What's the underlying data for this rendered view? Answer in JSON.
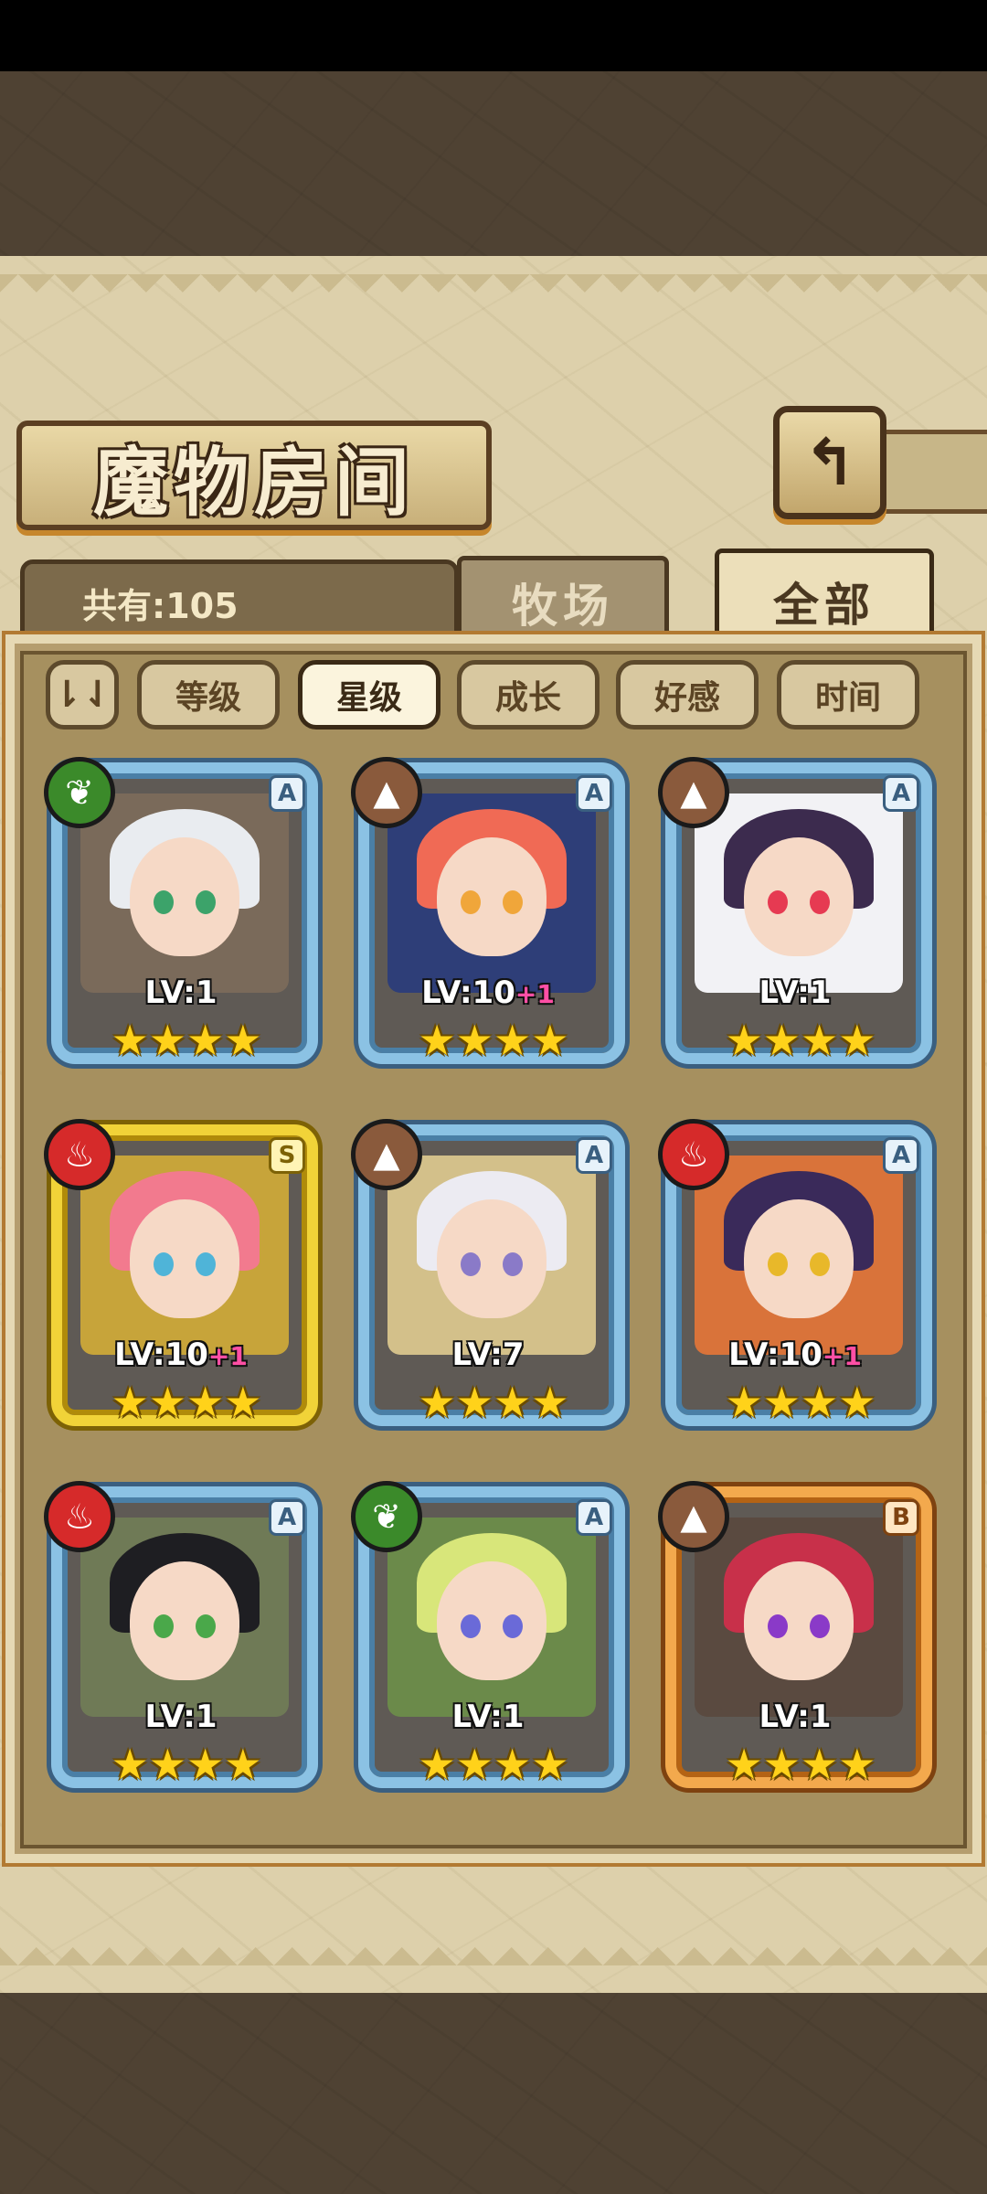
{
  "header": {
    "title": "魔物房间",
    "back_icon": "↰"
  },
  "count": {
    "label": "共有:105"
  },
  "tabs": [
    {
      "label": "牧场",
      "active": false
    },
    {
      "label": "全部",
      "active": true
    }
  ],
  "filters": {
    "toggle_icon": "⇂⇃",
    "items": [
      {
        "label": "等级",
        "active": false
      },
      {
        "label": "星级",
        "active": true
      },
      {
        "label": "成长",
        "active": false
      },
      {
        "label": "好感",
        "active": false
      },
      {
        "label": "时间",
        "active": false
      }
    ]
  },
  "monsters": [
    {
      "element": "grass",
      "element_icon": "❦",
      "rank": "A",
      "level": "LV:1",
      "plus": "",
      "stars": "★★★★",
      "hair": "#e9ecf0",
      "eye": "#3ca36a",
      "bg": "#7a6a5a"
    },
    {
      "element": "earth",
      "element_icon": "▲",
      "rank": "A",
      "level": "LV:10",
      "plus": "+1",
      "stars": "★★★★",
      "hair": "#f06a55",
      "eye": "#f0a63a",
      "bg": "#2e3e78"
    },
    {
      "element": "earth",
      "element_icon": "▲",
      "rank": "A",
      "level": "LV:1",
      "plus": "",
      "stars": "★★★★",
      "hair": "#3c2b4e",
      "eye": "#e63a52",
      "bg": "#f2f2f5"
    },
    {
      "element": "fire",
      "element_icon": "♨",
      "rank": "S",
      "level": "LV:10",
      "plus": "+1",
      "stars": "★★★★",
      "hair": "#f27a8e",
      "eye": "#4fb4d8",
      "bg": "#c7a43a"
    },
    {
      "element": "earth",
      "element_icon": "▲",
      "rank": "A",
      "level": "LV:7",
      "plus": "",
      "stars": "★★★★",
      "hair": "#ecebf2",
      "eye": "#8a7ac8",
      "bg": "#d3c08a"
    },
    {
      "element": "fire",
      "element_icon": "♨",
      "rank": "A",
      "level": "LV:10",
      "plus": "+1",
      "stars": "★★★★",
      "hair": "#3a2a5a",
      "eye": "#e8b82a",
      "bg": "#d9733a"
    },
    {
      "element": "fire",
      "element_icon": "♨",
      "rank": "A",
      "level": "LV:1",
      "plus": "",
      "stars": "★★★★",
      "hair": "#1e1e22",
      "eye": "#4aa84a",
      "bg": "#6f7a56"
    },
    {
      "element": "grass",
      "element_icon": "❦",
      "rank": "A",
      "level": "LV:1",
      "plus": "",
      "stars": "★★★★",
      "hair": "#d8e67a",
      "eye": "#6a6ad8",
      "bg": "#6b8a4a"
    },
    {
      "element": "earth",
      "element_icon": "▲",
      "rank": "B",
      "level": "LV:1",
      "plus": "",
      "stars": "★★★★",
      "hair": "#c8304a",
      "eye": "#8a3ac8",
      "bg": "#5a4a40"
    }
  ]
}
